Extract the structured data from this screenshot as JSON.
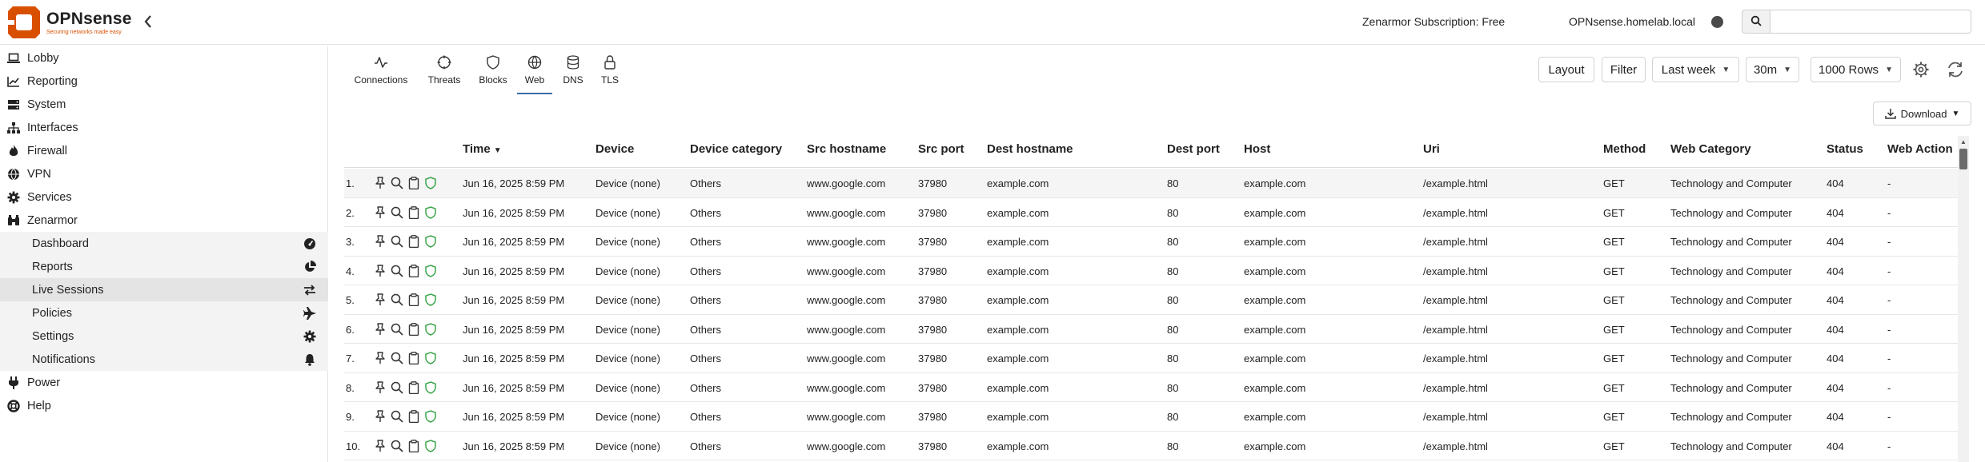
{
  "header": {
    "brand": "OPNsense",
    "tagline": "Securing networks made easy",
    "subscription": "Zenarmor Subscription: Free",
    "hostname": "OPNsense.homelab.local",
    "search": {
      "placeholder": "",
      "value": ""
    }
  },
  "sidebar": {
    "items": [
      {
        "label": "Lobby",
        "icon": "laptop-icon"
      },
      {
        "label": "Reporting",
        "icon": "chart-icon"
      },
      {
        "label": "System",
        "icon": "server-icon"
      },
      {
        "label": "Interfaces",
        "icon": "sitemap-icon"
      },
      {
        "label": "Firewall",
        "icon": "fire-icon"
      },
      {
        "label": "VPN",
        "icon": "globe-icon"
      },
      {
        "label": "Services",
        "icon": "cog-icon"
      },
      {
        "label": "Zenarmor",
        "icon": "binoculars-icon"
      }
    ],
    "zenarmor_items": [
      {
        "label": "Dashboard",
        "icon": "dashboard-icon"
      },
      {
        "label": "Reports",
        "icon": "pie-chart-icon"
      },
      {
        "label": "Live Sessions",
        "icon": "exchange-icon",
        "active": true
      },
      {
        "label": "Policies",
        "icon": "plane-icon"
      },
      {
        "label": "Settings",
        "icon": "gear-icon"
      },
      {
        "label": "Notifications",
        "icon": "bell-icon"
      }
    ],
    "bottom_items": [
      {
        "label": "Power",
        "icon": "plug-icon"
      },
      {
        "label": "Help",
        "icon": "lifebuoy-icon"
      }
    ]
  },
  "tabs": [
    {
      "label": "Connections",
      "icon": "activity-icon"
    },
    {
      "label": "Threats",
      "icon": "crosshair-icon"
    },
    {
      "label": "Blocks",
      "icon": "shield-icon"
    },
    {
      "label": "Web",
      "icon": "globe-icon",
      "active": true
    },
    {
      "label": "DNS",
      "icon": "database-icon"
    },
    {
      "label": "TLS",
      "icon": "lock-icon"
    }
  ],
  "toolbar": {
    "layout": "Layout",
    "filter": "Filter",
    "range": "Last week",
    "interval": "30m",
    "rows": "1000 Rows",
    "download": "Download"
  },
  "table": {
    "columns": [
      "Time",
      "Device",
      "Device category",
      "Src hostname",
      "Src port",
      "Dest hostname",
      "Dest port",
      "Host",
      "Uri",
      "Method",
      "Web Category",
      "Status",
      "Web Action"
    ],
    "sort": {
      "column": "Time",
      "direction": "desc"
    },
    "rows": [
      {
        "num": "1.",
        "time": "Jun 16, 2025 8:59 PM",
        "device": "Device (none)",
        "category": "Others",
        "src_host": "www.google.com",
        "src_port": "37980",
        "dest_host": "example.com",
        "dest_port": "80",
        "host": "example.com",
        "uri": "/example.html",
        "method": "GET",
        "web_category": "Technology and Computer",
        "status": "404",
        "action": "-"
      },
      {
        "num": "2.",
        "time": "Jun 16, 2025 8:59 PM",
        "device": "Device (none)",
        "category": "Others",
        "src_host": "www.google.com",
        "src_port": "37980",
        "dest_host": "example.com",
        "dest_port": "80",
        "host": "example.com",
        "uri": "/example.html",
        "method": "GET",
        "web_category": "Technology and Computer",
        "status": "404",
        "action": "-"
      },
      {
        "num": "3.",
        "time": "Jun 16, 2025 8:59 PM",
        "device": "Device (none)",
        "category": "Others",
        "src_host": "www.google.com",
        "src_port": "37980",
        "dest_host": "example.com",
        "dest_port": "80",
        "host": "example.com",
        "uri": "/example.html",
        "method": "GET",
        "web_category": "Technology and Computer",
        "status": "404",
        "action": "-"
      },
      {
        "num": "4.",
        "time": "Jun 16, 2025 8:59 PM",
        "device": "Device (none)",
        "category": "Others",
        "src_host": "www.google.com",
        "src_port": "37980",
        "dest_host": "example.com",
        "dest_port": "80",
        "host": "example.com",
        "uri": "/example.html",
        "method": "GET",
        "web_category": "Technology and Computer",
        "status": "404",
        "action": "-"
      },
      {
        "num": "5.",
        "time": "Jun 16, 2025 8:59 PM",
        "device": "Device (none)",
        "category": "Others",
        "src_host": "www.google.com",
        "src_port": "37980",
        "dest_host": "example.com",
        "dest_port": "80",
        "host": "example.com",
        "uri": "/example.html",
        "method": "GET",
        "web_category": "Technology and Computer",
        "status": "404",
        "action": "-"
      },
      {
        "num": "6.",
        "time": "Jun 16, 2025 8:59 PM",
        "device": "Device (none)",
        "category": "Others",
        "src_host": "www.google.com",
        "src_port": "37980",
        "dest_host": "example.com",
        "dest_port": "80",
        "host": "example.com",
        "uri": "/example.html",
        "method": "GET",
        "web_category": "Technology and Computer",
        "status": "404",
        "action": "-"
      },
      {
        "num": "7.",
        "time": "Jun 16, 2025 8:59 PM",
        "device": "Device (none)",
        "category": "Others",
        "src_host": "www.google.com",
        "src_port": "37980",
        "dest_host": "example.com",
        "dest_port": "80",
        "host": "example.com",
        "uri": "/example.html",
        "method": "GET",
        "web_category": "Technology and Computer",
        "status": "404",
        "action": "-"
      },
      {
        "num": "8.",
        "time": "Jun 16, 2025 8:59 PM",
        "device": "Device (none)",
        "category": "Others",
        "src_host": "www.google.com",
        "src_port": "37980",
        "dest_host": "example.com",
        "dest_port": "80",
        "host": "example.com",
        "uri": "/example.html",
        "method": "GET",
        "web_category": "Technology and Computer",
        "status": "404",
        "action": "-"
      },
      {
        "num": "9.",
        "time": "Jun 16, 2025 8:59 PM",
        "device": "Device (none)",
        "category": "Others",
        "src_host": "www.google.com",
        "src_port": "37980",
        "dest_host": "example.com",
        "dest_port": "80",
        "host": "example.com",
        "uri": "/example.html",
        "method": "GET",
        "web_category": "Technology and Computer",
        "status": "404",
        "action": "-"
      },
      {
        "num": "10.",
        "time": "Jun 16, 2025 8:59 PM",
        "device": "Device (none)",
        "category": "Others",
        "src_host": "www.google.com",
        "src_port": "37980",
        "dest_host": "example.com",
        "dest_port": "80",
        "host": "example.com",
        "uri": "/example.html",
        "method": "GET",
        "web_category": "Technology and Computer",
        "status": "404",
        "action": "-"
      }
    ],
    "row_icons": [
      "pin-icon",
      "magnifier-icon",
      "clipboard-icon",
      "shield-check-icon"
    ]
  },
  "colors": {
    "brand": "#d94f00",
    "accent": "#3b6ea5",
    "shield_ok": "#3aa64a"
  }
}
